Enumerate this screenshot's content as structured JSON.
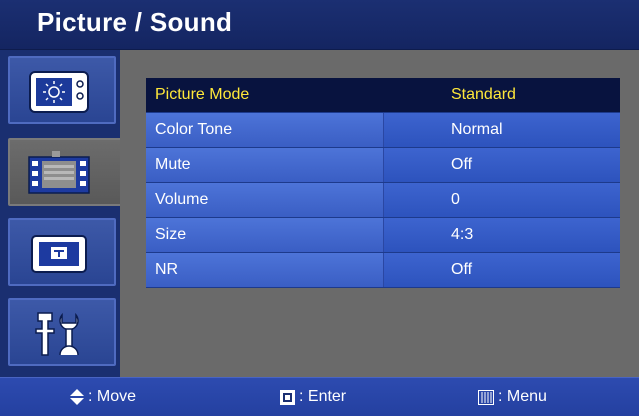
{
  "header": {
    "title": "Picture / Sound"
  },
  "sidebar": {
    "tabs": [
      {
        "icon": "picture-brightness-icon",
        "active": false
      },
      {
        "icon": "film-sound-icon",
        "active": true
      },
      {
        "icon": "screen-size-icon",
        "active": false
      },
      {
        "icon": "tools-icon",
        "active": false
      }
    ]
  },
  "menu": {
    "items": [
      {
        "label": "Picture Mode",
        "value": "Standard"
      },
      {
        "label": "Color Tone",
        "value": "Normal"
      },
      {
        "label": "Mute",
        "value": "Off"
      },
      {
        "label": "Volume",
        "value": "0"
      },
      {
        "label": "Size",
        "value": "4:3"
      },
      {
        "label": "NR",
        "value": "Off"
      }
    ],
    "selected_index": 0
  },
  "footer": {
    "move": {
      "icon": "up-down-arrows-icon",
      "label": ": Move"
    },
    "enter": {
      "icon": "enter-square-icon",
      "label": ": Enter"
    },
    "menu": {
      "icon": "menu-bars-icon",
      "label": ": Menu"
    }
  },
  "colors": {
    "selected_text": "#ffe83a",
    "selected_bg": "#08133f",
    "row_bg": "#3a5ec4",
    "content_bg": "#6a6a6a"
  }
}
